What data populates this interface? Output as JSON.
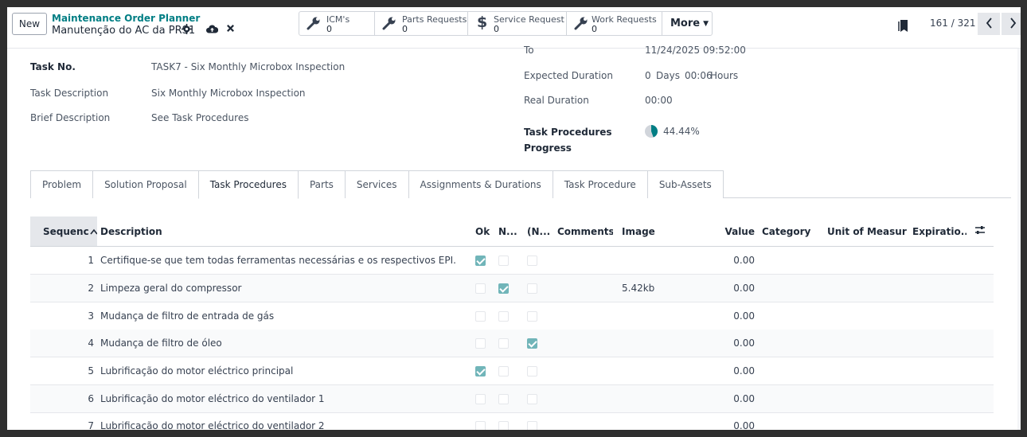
{
  "control_panel": {
    "new_label": "New",
    "breadcrumb_parent": "Maintenance Order Planner",
    "breadcrumb_current": "Manutenção do AC da PRS1",
    "smart_buttons": [
      {
        "label": "ICM's",
        "count": "0",
        "icon": "wrench-icon"
      },
      {
        "label": "Parts Requests",
        "count": "0",
        "icon": "wrench-icon"
      },
      {
        "label": "Service Request",
        "count": "0",
        "icon": "dollar-icon"
      },
      {
        "label": "Work Requests",
        "count": "0",
        "icon": "wrench-icon"
      }
    ],
    "more_label": "More",
    "pager": "161 / 321"
  },
  "form": {
    "task_no_label": "Task No.",
    "task_no": "TASK7 - Six Monthly Microbox Inspection",
    "task_description_label": "Task Description",
    "task_description": "Six Monthly Microbox Inspection",
    "brief_description_label": "Brief Description",
    "brief_description": "See Task Procedures",
    "to_label": "To",
    "to_value": "11/24/2025 09:52:00",
    "expected_duration_label": "Expected Duration",
    "expected_duration_days": "0",
    "expected_duration_days_unit": "Days",
    "expected_duration_hours": "00:06",
    "expected_duration_hours_unit": "Hours",
    "real_duration_label": "Real Duration",
    "real_duration": "00:00",
    "progress_label": "Task Procedures Progress",
    "progress_value": "44.44%",
    "progress_fraction": 0.4444
  },
  "tabs": [
    "Problem",
    "Solution Proposal",
    "Task Procedures",
    "Parts",
    "Services",
    "Assignments & Durations",
    "Task Procedure",
    "Sub-Assets"
  ],
  "active_tab": "Task Procedures",
  "table": {
    "columns": {
      "sequence": "Sequenc",
      "description": "Description",
      "ok": "Ok",
      "n": "N...",
      "na": "(N...",
      "comments": "Comments",
      "image": "Image",
      "value": "Value",
      "category": "Category",
      "uom": "Unit of Measure",
      "expiration": "Expiratio..."
    },
    "rows": [
      {
        "seq": "1",
        "description": "Certifique-se que tem todas ferramentas necessárias e os respectivos EPI.",
        "ok": true,
        "n": false,
        "na": false,
        "image": "",
        "value": "0.00"
      },
      {
        "seq": "2",
        "description": "Limpeza geral do compressor",
        "ok": false,
        "n": true,
        "na": false,
        "image": "5.42kb",
        "value": "0.00"
      },
      {
        "seq": "3",
        "description": "Mudança de filtro de entrada de gás",
        "ok": false,
        "n": false,
        "na": false,
        "image": "",
        "value": "0.00"
      },
      {
        "seq": "4",
        "description": "Mudança de filtro de óleo",
        "ok": false,
        "n": false,
        "na": true,
        "image": "",
        "value": "0.00"
      },
      {
        "seq": "5",
        "description": "Lubrificação do motor eléctrico principal",
        "ok": true,
        "n": false,
        "na": false,
        "image": "",
        "value": "0.00"
      },
      {
        "seq": "6",
        "description": "Lubrificação do motor eléctrico do ventilador 1",
        "ok": false,
        "n": false,
        "na": false,
        "image": "",
        "value": "0.00"
      },
      {
        "seq": "7",
        "description": "Lubrificação do motor eléctrico do ventilador 2",
        "ok": false,
        "n": false,
        "na": false,
        "image": "",
        "value": "0.00"
      }
    ]
  },
  "colors": {
    "accent": "#017e84",
    "checkbox_checked": "#71b5b9"
  }
}
